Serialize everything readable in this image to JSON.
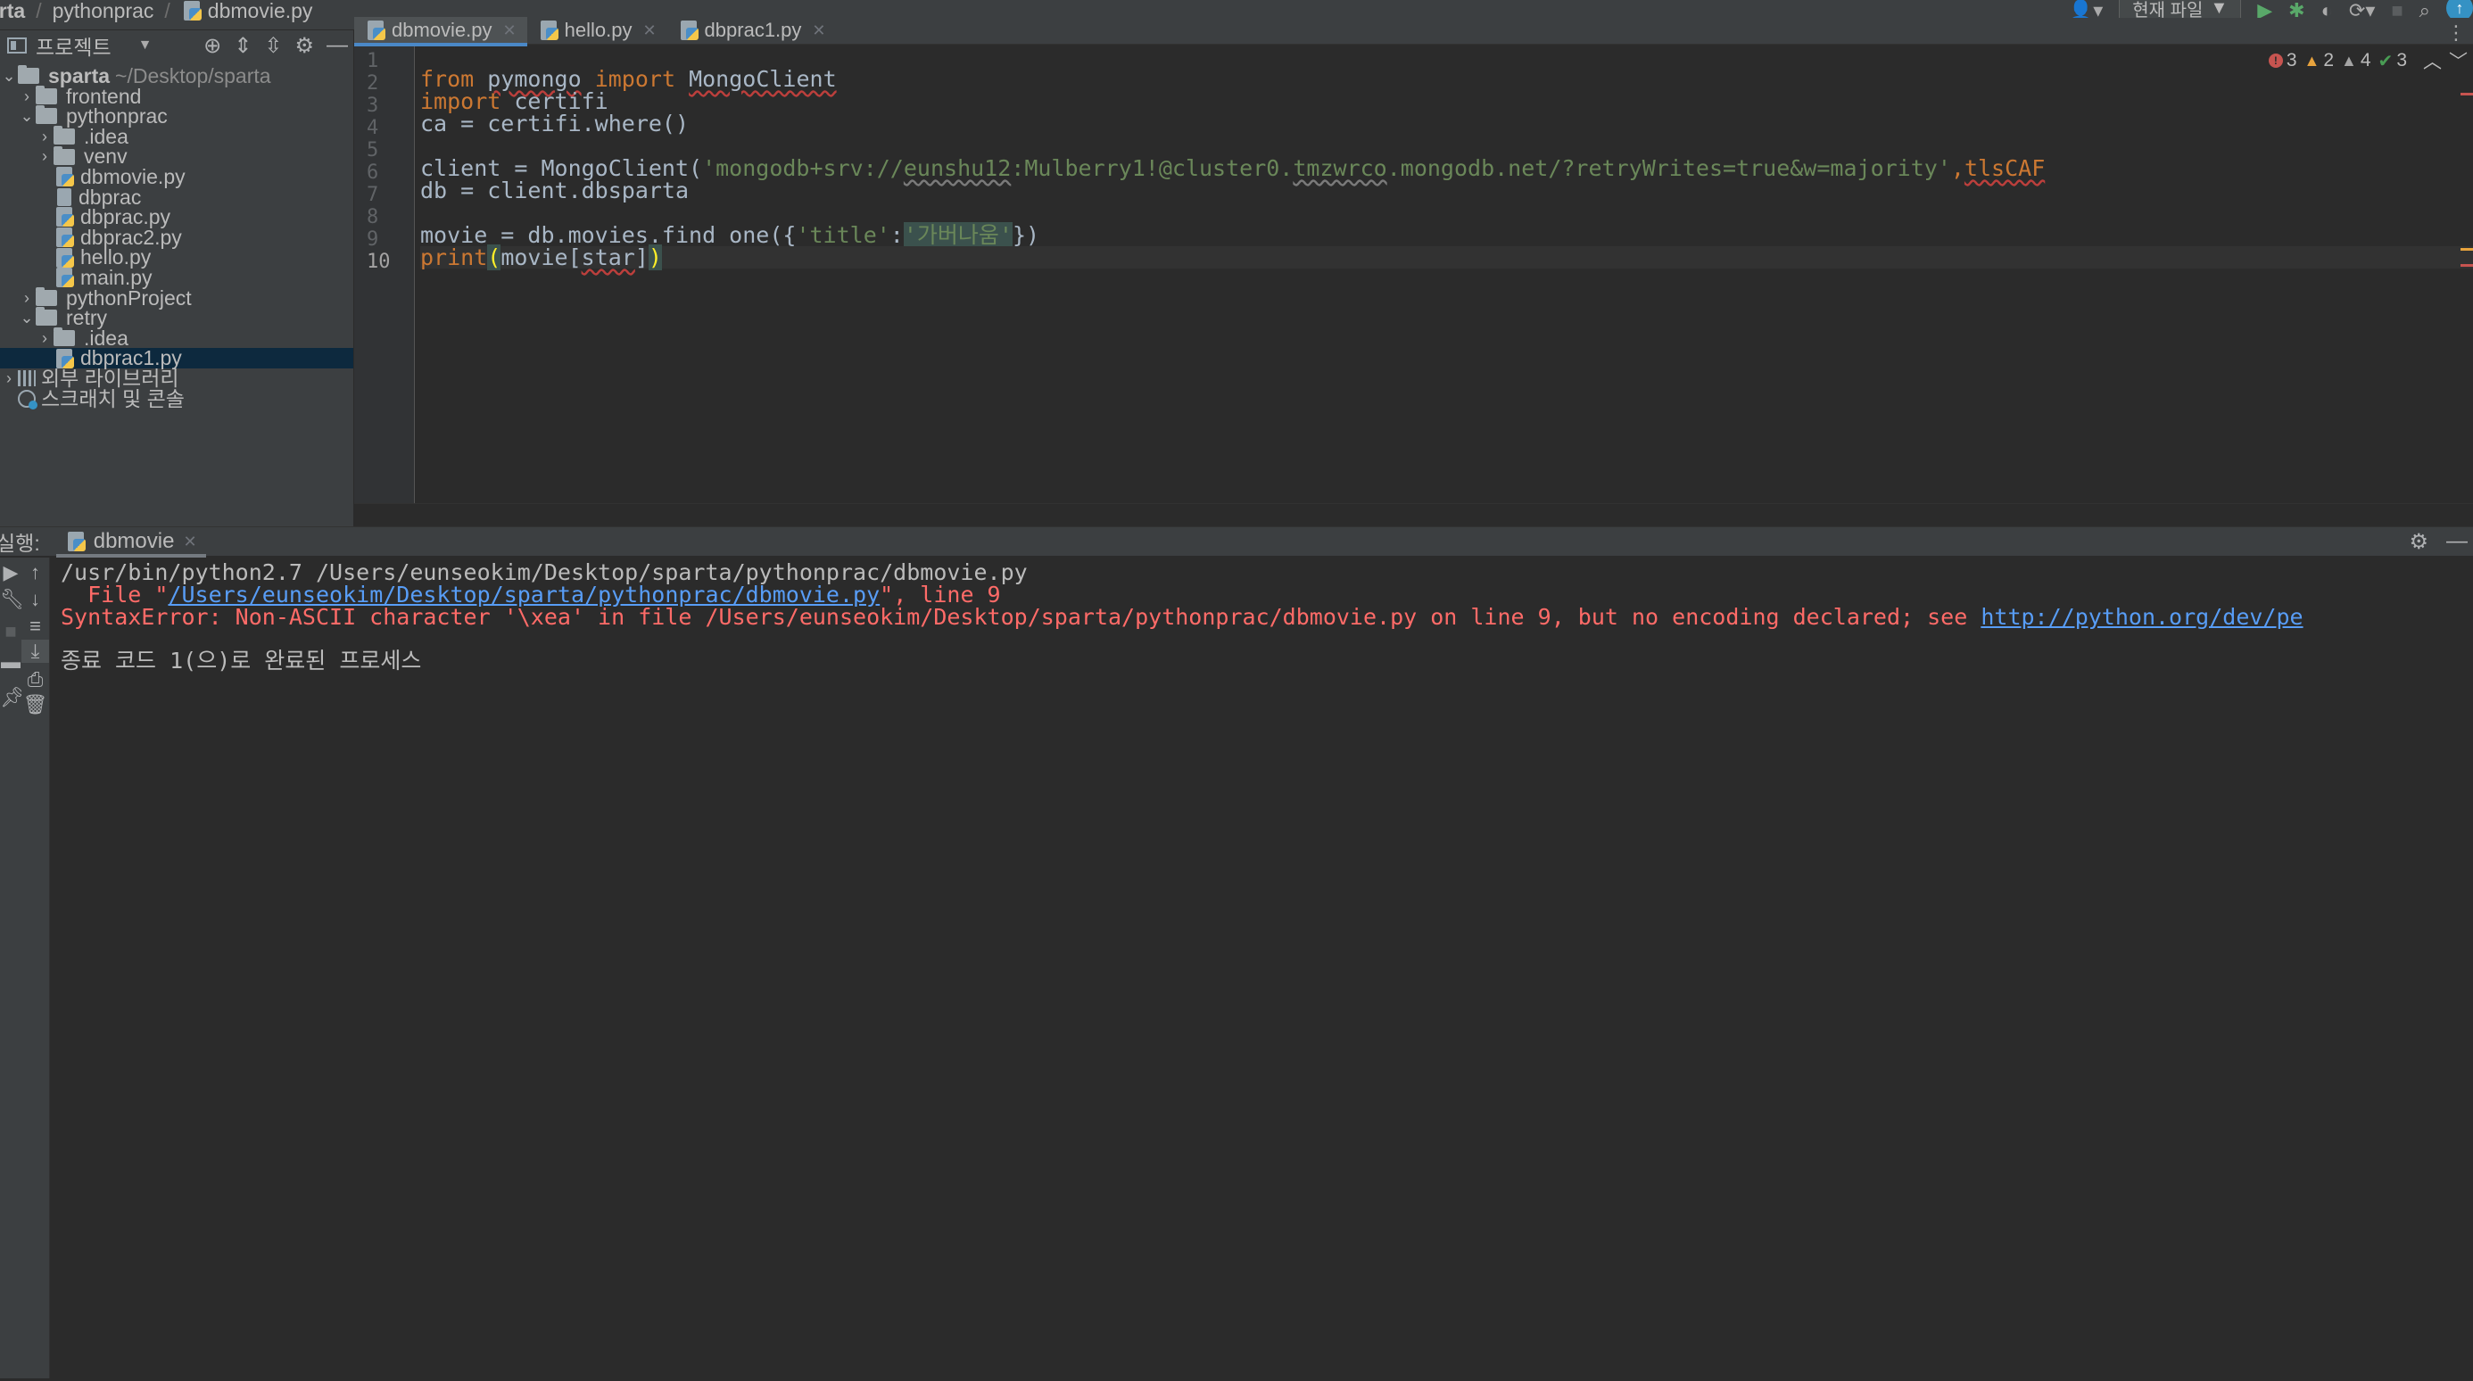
{
  "breadcrumb": [
    "arta",
    "pythonprac",
    "dbmovie.py"
  ],
  "toolbar": {
    "run_config_label": "현재 파일",
    "icons": [
      "user-icon",
      "run-icon",
      "debug-icon",
      "coverage-icon",
      "profile-icon",
      "stop-icon",
      "search-icon",
      "update-icon"
    ]
  },
  "project_panel": {
    "title": "프로젝트",
    "tree": [
      {
        "label": "sparta",
        "path": "~/Desktop/sparta",
        "type": "folder",
        "expanded": true,
        "depth": 0
      },
      {
        "label": "frontend",
        "type": "folder",
        "expanded": false,
        "depth": 1
      },
      {
        "label": "pythonprac",
        "type": "folder",
        "expanded": true,
        "depth": 1
      },
      {
        "label": ".idea",
        "type": "folder",
        "expanded": false,
        "depth": 2
      },
      {
        "label": "venv",
        "type": "folder",
        "expanded": false,
        "depth": 2
      },
      {
        "label": "dbmovie.py",
        "type": "python",
        "depth": 2
      },
      {
        "label": "dbprac",
        "type": "file",
        "depth": 2
      },
      {
        "label": "dbprac.py",
        "type": "python",
        "depth": 2
      },
      {
        "label": "dbprac2.py",
        "type": "python",
        "depth": 2
      },
      {
        "label": "hello.py",
        "type": "python",
        "depth": 2
      },
      {
        "label": "main.py",
        "type": "python",
        "depth": 2
      },
      {
        "label": "pythonProject",
        "type": "folder",
        "expanded": false,
        "depth": 1
      },
      {
        "label": "retry",
        "type": "folder",
        "expanded": true,
        "depth": 1
      },
      {
        "label": ".idea",
        "type": "folder",
        "expanded": false,
        "depth": 2
      },
      {
        "label": "dbprac1.py",
        "type": "python",
        "depth": 2,
        "selected": true
      },
      {
        "label": "외부 라이브러리",
        "type": "library",
        "expanded": false,
        "depth": 0
      },
      {
        "label": "스크래치 및 콘솔",
        "type": "scratch",
        "depth": 0
      }
    ]
  },
  "editor": {
    "tabs": [
      {
        "label": "dbmovie.py",
        "active": true
      },
      {
        "label": "hello.py",
        "active": false
      },
      {
        "label": "dbprac1.py",
        "active": false
      }
    ],
    "inspections": {
      "errors": "3",
      "warnings": "2",
      "weak_warnings": "4",
      "ok": "3"
    },
    "line_numbers": [
      "1",
      "2",
      "3",
      "4",
      "5",
      "6",
      "7",
      "8",
      "9",
      "10"
    ],
    "code": {
      "l2_from": "from",
      "l2_module": "pymongo",
      "l2_import": "import",
      "l2_class": "MongoClient",
      "l3_import": "import",
      "l3_module": " certifi",
      "l4": "ca = certifi.where()",
      "l6_prefix": "client = MongoClient(",
      "l6_str_a": "'mongodb+srv://",
      "l6_str_user": "eunshu12",
      "l6_str_b": ":Mulberry1!@cluster0.",
      "l6_str_host": "tmzwrco",
      "l6_str_c": ".mongodb.net/?retryWrites=true&w=majority'",
      "l6_comma": ",",
      "l6_tail": "tlsCAF",
      "l7": "db = client.dbsparta",
      "l9_prefix": "movie = db.movies.find_one({",
      "l9_key": "'title'",
      "l9_colon": ":",
      "l9_val": "'가버나움'",
      "l9_suffix": "})",
      "l10_print": "print",
      "l10_open": "(",
      "l10_mid": "movie[",
      "l10_star": "star",
      "l10_bracket": "]",
      "l10_close": ")"
    }
  },
  "run_panel": {
    "label": "실행:",
    "tab_label": "dbmovie",
    "console": {
      "line1": "/usr/bin/python2.7 /Users/eunseokim/Desktop/sparta/pythonprac/dbmovie.py",
      "line2_prefix": "  File \"",
      "line2_link": "/Users/eunseokim/Desktop/sparta/pythonprac/dbmovie.py",
      "line2_suffix": "\", line 9",
      "line3_text": "SyntaxError: Non-ASCII character '\\xea' in file /Users/eunseokim/Desktop/sparta/pythonprac/dbmovie.py on line 9, but no encoding declared; see ",
      "line3_link": "http://python.org/dev/pe",
      "line4": "종료 코드 1(으)로 완료된 프로세스"
    }
  },
  "colors": {
    "background": "#2b2b2b",
    "panel": "#3c3f41",
    "keyword": "#cc7832",
    "string": "#6a8759",
    "error": "#ff6b68",
    "link": "#589df6",
    "selection": "#0d293e",
    "accent": "#4a88c7"
  }
}
